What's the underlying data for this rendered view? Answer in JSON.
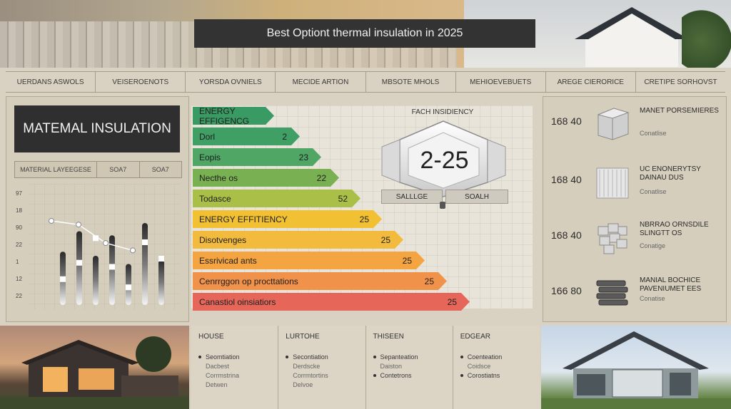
{
  "header": {
    "title": "Best Optiont thermal insulation in 2025"
  },
  "nav": [
    "UERDANS ASWOLS",
    "VEISEROENOTS",
    "YORSDA OVNIELS",
    "MECIDE ARTION",
    "MBSOTE MHOLS",
    "MEHIOEVEBUETS",
    "AREGE CIERORICE",
    "CRETIPE SORHOVST"
  ],
  "material": {
    "title": "MATEMAL INSULATION",
    "row": [
      "MATERIAL LAYEEGESE",
      "SOA7",
      "SOA7"
    ],
    "chart_yticks": [
      "97",
      "18",
      "90",
      "22",
      "1",
      "12",
      "22"
    ]
  },
  "chart_data": {
    "type": "bar",
    "categories": [],
    "values": [
      0.65,
      0.9,
      0.6,
      0.85,
      0.5,
      1.0,
      0.55
    ],
    "markers": [
      0.35,
      0.55,
      0.85,
      0.5,
      0.25,
      0.8,
      0.6
    ],
    "line": {
      "points": [
        [
          0,
          0.85
        ],
        [
          1,
          0.8
        ],
        [
          2,
          0.55
        ],
        [
          3,
          0.45
        ]
      ]
    }
  },
  "ratings": {
    "items": [
      {
        "label": "ENERGY EFFIGENCG",
        "value": "",
        "color": "#3a9a63"
      },
      {
        "label": "Dorl",
        "value": "2",
        "color": "#3f9f64"
      },
      {
        "label": "Eopis",
        "value": "23",
        "color": "#4fa665"
      },
      {
        "label": "Necthe os",
        "value": "22",
        "color": "#79b052"
      },
      {
        "label": "Todasce",
        "value": "52",
        "color": "#a9bf48"
      },
      {
        "label": "ENERGY EFFITIENCY",
        "value": "25",
        "color": "#f2c033"
      },
      {
        "label": "Disotvenges",
        "value": "25",
        "color": "#f3bb3d"
      },
      {
        "label": "Essrivicad ants",
        "value": "25",
        "color": "#f4a440"
      },
      {
        "label": "Cenrrggon op procttations",
        "value": "25",
        "color": "#f0924a"
      },
      {
        "label": "Canastiol oinsiatiors",
        "value": "25",
        "color": "#e6665a"
      }
    ]
  },
  "efficiency": {
    "title": "FACH INSIDIENCY",
    "value": "2-25",
    "left_label": "SALLLGE",
    "right_label": "SOALH"
  },
  "materials": [
    {
      "num": "168 40",
      "name": "MANET PORSEMIERES",
      "sub": "Conatlise"
    },
    {
      "num": "168 40",
      "name": "UC ENONERYTSY DAINAU DUS",
      "sub": "Conatlise"
    },
    {
      "num": "168 40",
      "name": "NBRRAO ORNSDILE SLINGTT OS",
      "sub": "Conatige"
    },
    {
      "num": "166 80",
      "name": "MANIAL BOCHICE PAVENIUMET EES",
      "sub": "Conatise"
    }
  ],
  "bottom": [
    {
      "head": "HOUSE",
      "items": [
        "Seomtiation",
        "Dacbest",
        "Corrmstrina",
        "Detwen"
      ]
    },
    {
      "head": "LURTOHE",
      "items": [
        "Secontiation",
        "Derdscke",
        "Corrmtortins",
        "Delvoe"
      ]
    },
    {
      "head": "THISEEN",
      "items": [
        "Sepanteation",
        "Daiston",
        "Contetrons"
      ]
    },
    {
      "head": "EDGEAR",
      "items": [
        "Coenteation",
        "Coidsce",
        "Corostiatns"
      ]
    }
  ]
}
